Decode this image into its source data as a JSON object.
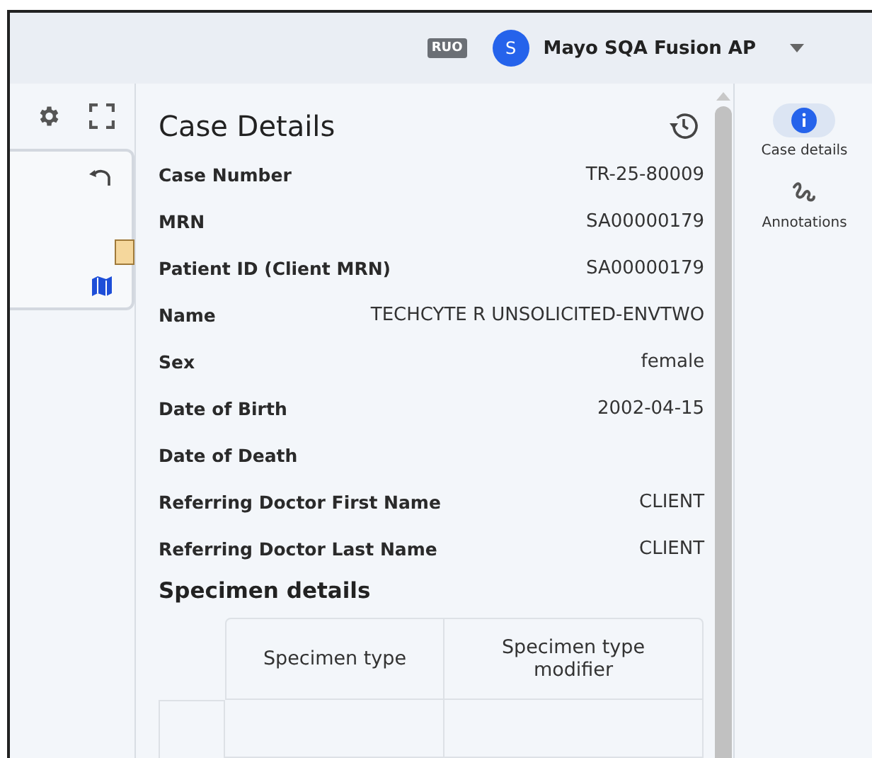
{
  "header": {
    "badge": "RUO",
    "user": {
      "initial": "S",
      "name": "Mayo SQA Fusion AP"
    }
  },
  "case_details": {
    "title": "Case Details",
    "fields": [
      {
        "label": "Case Number",
        "value": "TR-25-80009"
      },
      {
        "label": "MRN",
        "value": "SA00000179"
      },
      {
        "label": "Patient ID (Client MRN)",
        "value": "SA00000179"
      },
      {
        "label": "Name",
        "value": "TECHCYTE R UNSOLICITED-ENVTWO"
      },
      {
        "label": "Sex",
        "value": "female"
      },
      {
        "label": "Date of Birth",
        "value": "2002-04-15"
      },
      {
        "label": "Date of Death"
      },
      {
        "label": "Referring Doctor First Name",
        "value": "CLIENT"
      },
      {
        "label": "Referring Doctor Last Name",
        "value": "CLIENT"
      }
    ],
    "specimen_heading": "Specimen details",
    "specimen_columns": [
      "Specimen type",
      "Specimen type modifier"
    ]
  },
  "right_rail": [
    {
      "label": "Case details",
      "selected": true,
      "kind": "info"
    },
    {
      "label": "Annotations",
      "selected": false,
      "kind": "squiggle"
    }
  ]
}
